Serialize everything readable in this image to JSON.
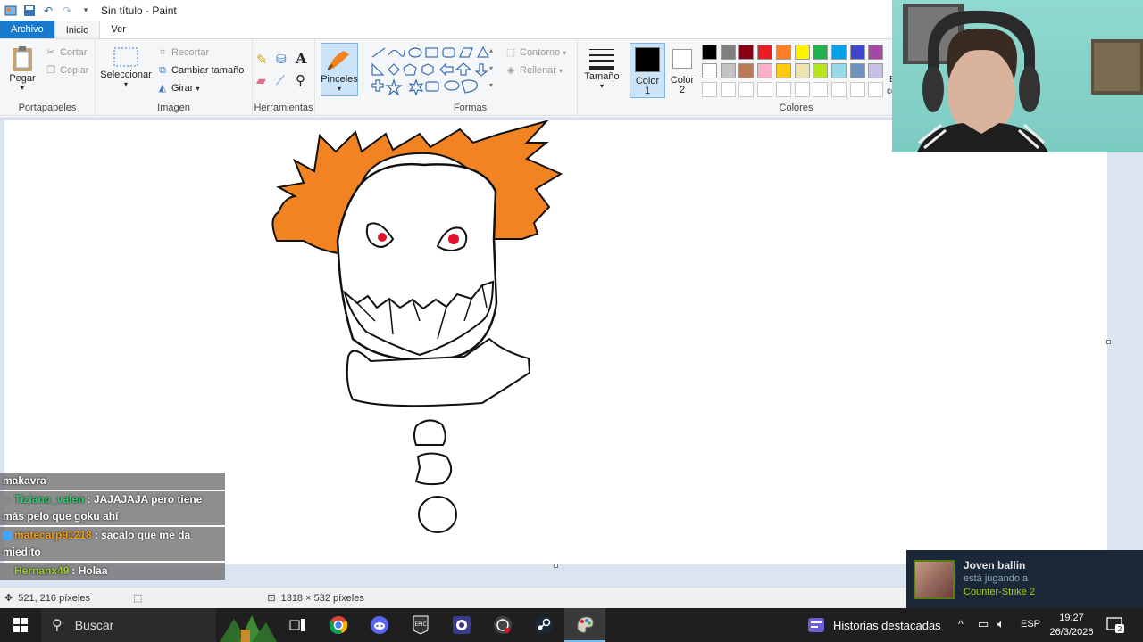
{
  "window": {
    "title": "Sin título - Paint"
  },
  "tabs": {
    "file": "Archivo",
    "home": "Inicio",
    "view": "Ver"
  },
  "ribbon": {
    "clipboard": {
      "paste": "Pegar",
      "cut": "Cortar",
      "copy": "Copiar",
      "label": "Portapapeles"
    },
    "image": {
      "select": "Seleccionar",
      "crop": "Recortar",
      "resize": "Cambiar tamaño",
      "rotate": "Girar",
      "label": "Imagen"
    },
    "tools": {
      "label": "Herramientas",
      "text_glyph": "A"
    },
    "brushes": {
      "label": "Pinceles"
    },
    "shapes": {
      "outline": "Contorno",
      "fill": "Rellenar",
      "label": "Formas"
    },
    "size": {
      "label": "Tamaño"
    },
    "color1": {
      "label1": "Color",
      "label2": "1"
    },
    "color2": {
      "label1": "Color",
      "label2": "2"
    },
    "colors": {
      "label": "Colores",
      "row1": [
        "#000000",
        "#7f7f7f",
        "#880015",
        "#ed1c24",
        "#ff7f27",
        "#fff200",
        "#22b14c",
        "#00a2e8",
        "#3f48cc",
        "#a349a4"
      ],
      "row2": [
        "#ffffff",
        "#c3c3c3",
        "#b97a57",
        "#ffaec9",
        "#ffc90e",
        "#efe4b0",
        "#b5e61d",
        "#99d9ea",
        "#7092be",
        "#c8bfe7"
      ],
      "row3": [
        "#ffffff",
        "#ffffff",
        "#ffffff",
        "#ffffff",
        "#ffffff",
        "#ffffff",
        "#ffffff",
        "#ffffff",
        "#ffffff",
        "#ffffff"
      ]
    },
    "edit_colors_partial": "E",
    "edit_colors_partial2": "co"
  },
  "status": {
    "cursor_pos": "521, 216 píxeles",
    "canvas_size": "1318 × 532 píxeles"
  },
  "chat": [
    {
      "user": "makavra",
      "message": "",
      "user_color": "#ffffff"
    },
    {
      "user": "Tiziano_valen",
      "message": ": JAJAJAJA pero tiene más pelo que goku ahí",
      "user_color": "#2ecc71"
    },
    {
      "user": "matecarp91218",
      "message": ": sacalo que me da miedito",
      "user_color": "#f39c12"
    },
    {
      "user": "Hernanx49",
      "message": ": Holaa",
      "user_color": "#9acd32"
    }
  ],
  "toast": {
    "name": "Joven ballin",
    "status": "está jugando a",
    "game": "Counter-Strike 2"
  },
  "taskbar": {
    "search": "Buscar",
    "news": "Historias destacadas",
    "lang": "ESP",
    "time": "19:27",
    "date": "26/3/2026"
  },
  "colors": {
    "accent": "#1979ca",
    "hair_orange": "#f28322",
    "eye_red": "#e3122b",
    "toast_bg": "#1b2838",
    "toast_green": "#a4d007"
  }
}
